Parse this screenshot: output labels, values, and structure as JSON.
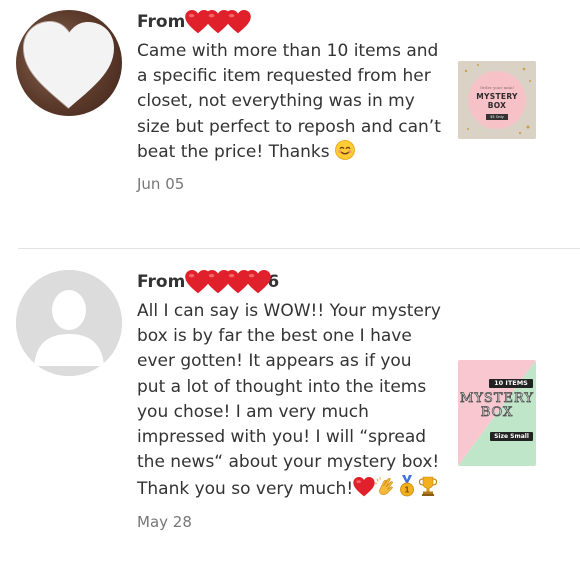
{
  "reviews": [
    {
      "from_label": "From",
      "from_partial": "",
      "text_parts": [
        "Came with more than 10 items and a specific item requested from her closet, not everything was in my size but perfect to reposh and can’t beat the price! Thanks"
      ],
      "date": "Jun 05",
      "product": {
        "small_text": "Order your mini!",
        "title_line1": "MYSTERY",
        "title_line2": "BOX",
        "button_text": "$5 Only"
      }
    },
    {
      "from_label": "From",
      "from_partial": "6",
      "text": "All I can say is WOW!! Your mystery box is by far the best one I have ever gotten! It appears as if you put a lot of thought into the items you chose! I am very much impressed with you! I will “spread the news“ about your mystery box! Thank you so very much!",
      "date": "May 28",
      "product": {
        "badge_top": "10 ITEMS",
        "title_line1": "MYSTERY",
        "title_line2": "BOX",
        "badge_bottom": "Size Small"
      }
    }
  ],
  "icons": {
    "heart": "red-heart-emoji",
    "smile": "smiling-face-emoji",
    "clap": "clapping-hands-emoji",
    "medal": "gold-medal-emoji",
    "trophy": "trophy-emoji"
  },
  "colors": {
    "heart": "#e0202a",
    "date": "#777777",
    "divider": "#e3e3e3"
  }
}
